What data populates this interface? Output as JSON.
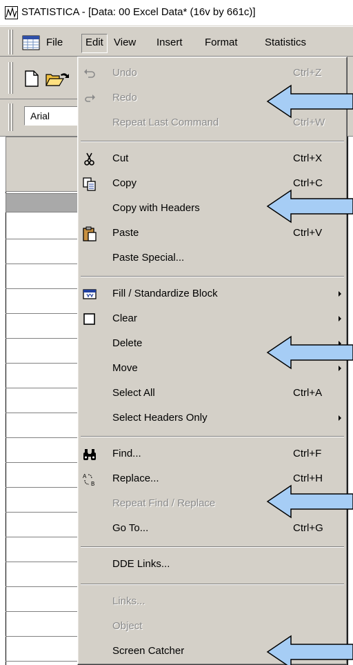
{
  "window": {
    "title": "STATISTICA - [Data: 00 Excel Data* (16v by 661c)]"
  },
  "menubar": {
    "items": [
      {
        "label": "File"
      },
      {
        "label": "Edit"
      },
      {
        "label": "View"
      },
      {
        "label": "Insert"
      },
      {
        "label": "Format"
      },
      {
        "label": "Statistics"
      }
    ],
    "active": "Edit"
  },
  "toolbar": {
    "font_name": "Arial"
  },
  "edit_menu": {
    "items": [
      {
        "label": "Undo",
        "shortcut": "Ctrl+Z",
        "enabled": false,
        "icon": "undo-icon"
      },
      {
        "label": "Redo",
        "shortcut": "",
        "enabled": false,
        "icon": "redo-icon"
      },
      {
        "label": "Repeat Last Command",
        "shortcut": "Ctrl+W",
        "enabled": false
      },
      {
        "label": "Cut",
        "shortcut": "Ctrl+X",
        "enabled": true,
        "icon": "scissors-icon"
      },
      {
        "label": "Copy",
        "shortcut": "Ctrl+C",
        "enabled": true,
        "icon": "copy-icon"
      },
      {
        "label": "Copy with Headers",
        "shortcut": "",
        "enabled": true
      },
      {
        "label": "Paste",
        "shortcut": "Ctrl+V",
        "enabled": true,
        "icon": "paste-icon"
      },
      {
        "label": "Paste Special...",
        "shortcut": "",
        "enabled": true
      },
      {
        "label": "Fill / Standardize Block",
        "shortcut": "",
        "enabled": true,
        "submenu": true,
        "icon": "fill-block-icon"
      },
      {
        "label": "Clear",
        "shortcut": "",
        "enabled": true,
        "submenu": true,
        "icon": "clear-icon"
      },
      {
        "label": "Delete",
        "shortcut": "",
        "enabled": true,
        "submenu": true
      },
      {
        "label": "Move",
        "shortcut": "",
        "enabled": true,
        "submenu": true
      },
      {
        "label": "Select All",
        "shortcut": "Ctrl+A",
        "enabled": true
      },
      {
        "label": "Select Headers Only",
        "shortcut": "",
        "enabled": true,
        "submenu": true
      },
      {
        "label": "Find...",
        "shortcut": "Ctrl+F",
        "enabled": true,
        "icon": "binoculars-icon"
      },
      {
        "label": "Replace...",
        "shortcut": "Ctrl+H",
        "enabled": true,
        "icon": "replace-icon"
      },
      {
        "label": "Repeat Find / Replace",
        "shortcut": "",
        "enabled": false
      },
      {
        "label": "Go To...",
        "shortcut": "Ctrl+G",
        "enabled": true
      },
      {
        "label": "DDE Links...",
        "shortcut": "",
        "enabled": true
      },
      {
        "label": "Links...",
        "shortcut": "",
        "enabled": false
      },
      {
        "label": "Object",
        "shortcut": "",
        "enabled": false
      },
      {
        "label": "Screen Catcher",
        "shortcut": "",
        "enabled": true
      }
    ]
  },
  "colors": {
    "menu_face": "#d4d0c8",
    "disabled_text": "#8a8a8a",
    "callout_arrow_fill": "#a6cdf5"
  }
}
